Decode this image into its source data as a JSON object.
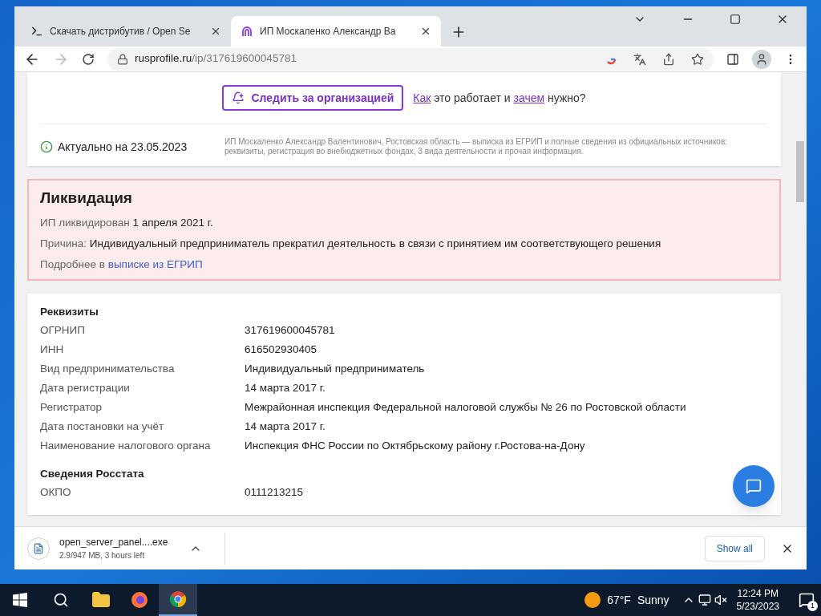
{
  "tabs": [
    {
      "title": "Скачать дистрибутив / Open Se",
      "kind": "terminal",
      "selected": false
    },
    {
      "title": "ИП Москаленко Александр Ва",
      "kind": "profile",
      "selected": true
    }
  ],
  "address": {
    "host": "rusprofile.ru",
    "path": "/ip/317619600045781"
  },
  "page": {
    "follow_button": "Следить за организацией",
    "how": [
      {
        "text": "Как",
        "link": true
      },
      {
        "text": " это работает и ",
        "link": false
      },
      {
        "text": "зачем",
        "link": true
      },
      {
        "text": " нужно?",
        "link": false
      }
    ],
    "actual": "Актуально на 23.05.2023",
    "summary": "ИП Москаленко Александр Валентинович, Ростовская область — выписка из ЕГРИП и полные сведения из официальных источников: реквизиты, регистрация во внебюджетных фондах, 3 вида деятельности и прочая информация.",
    "liquidation": {
      "title": "Ликвидация",
      "status_label": "ИП ликвидирован",
      "status_date": "1 апреля 2021 г.",
      "reason_label": "Причина:",
      "reason": "Индивидуальный предприниматель прекратил деятельность в связи с принятием им соответствующего решения",
      "more_label": "Подробнее в",
      "more_link": "выписке из ЕГРИП"
    },
    "sections": [
      {
        "title": "Реквизиты",
        "rows": [
          {
            "label": "ОГРНИП",
            "value": "317619600045781"
          },
          {
            "label": "ИНН",
            "value": "616502930405"
          },
          {
            "label": "Вид предпринимательства",
            "value": "Индивидуальный предприниматель"
          },
          {
            "label": "Дата регистрации",
            "value": "14 марта 2017 г."
          },
          {
            "label": "Регистратор",
            "value": "Межрайонная инспекция Федеральной налоговой службы № 26 по Ростовской области"
          },
          {
            "label": "Дата постановки на учёт",
            "value": "14 марта 2017 г."
          },
          {
            "label": "Наименование налогового органа",
            "value": "Инспекция ФНС России по Октябрьскому району г.Ростова-на-Дону"
          }
        ]
      },
      {
        "title": "Сведения Росстата",
        "rows": [
          {
            "label": "ОКПО",
            "value": "0111213215"
          }
        ]
      }
    ]
  },
  "download": {
    "file": "open_server_panel....exe",
    "status": "2.9/947 MB, 3 hours left",
    "show_all": "Show all"
  },
  "taskbar": {
    "temperature": "67°F",
    "weather": "Sunny",
    "time": "12:24 PM",
    "date": "5/23/2023",
    "notifications": "1"
  }
}
